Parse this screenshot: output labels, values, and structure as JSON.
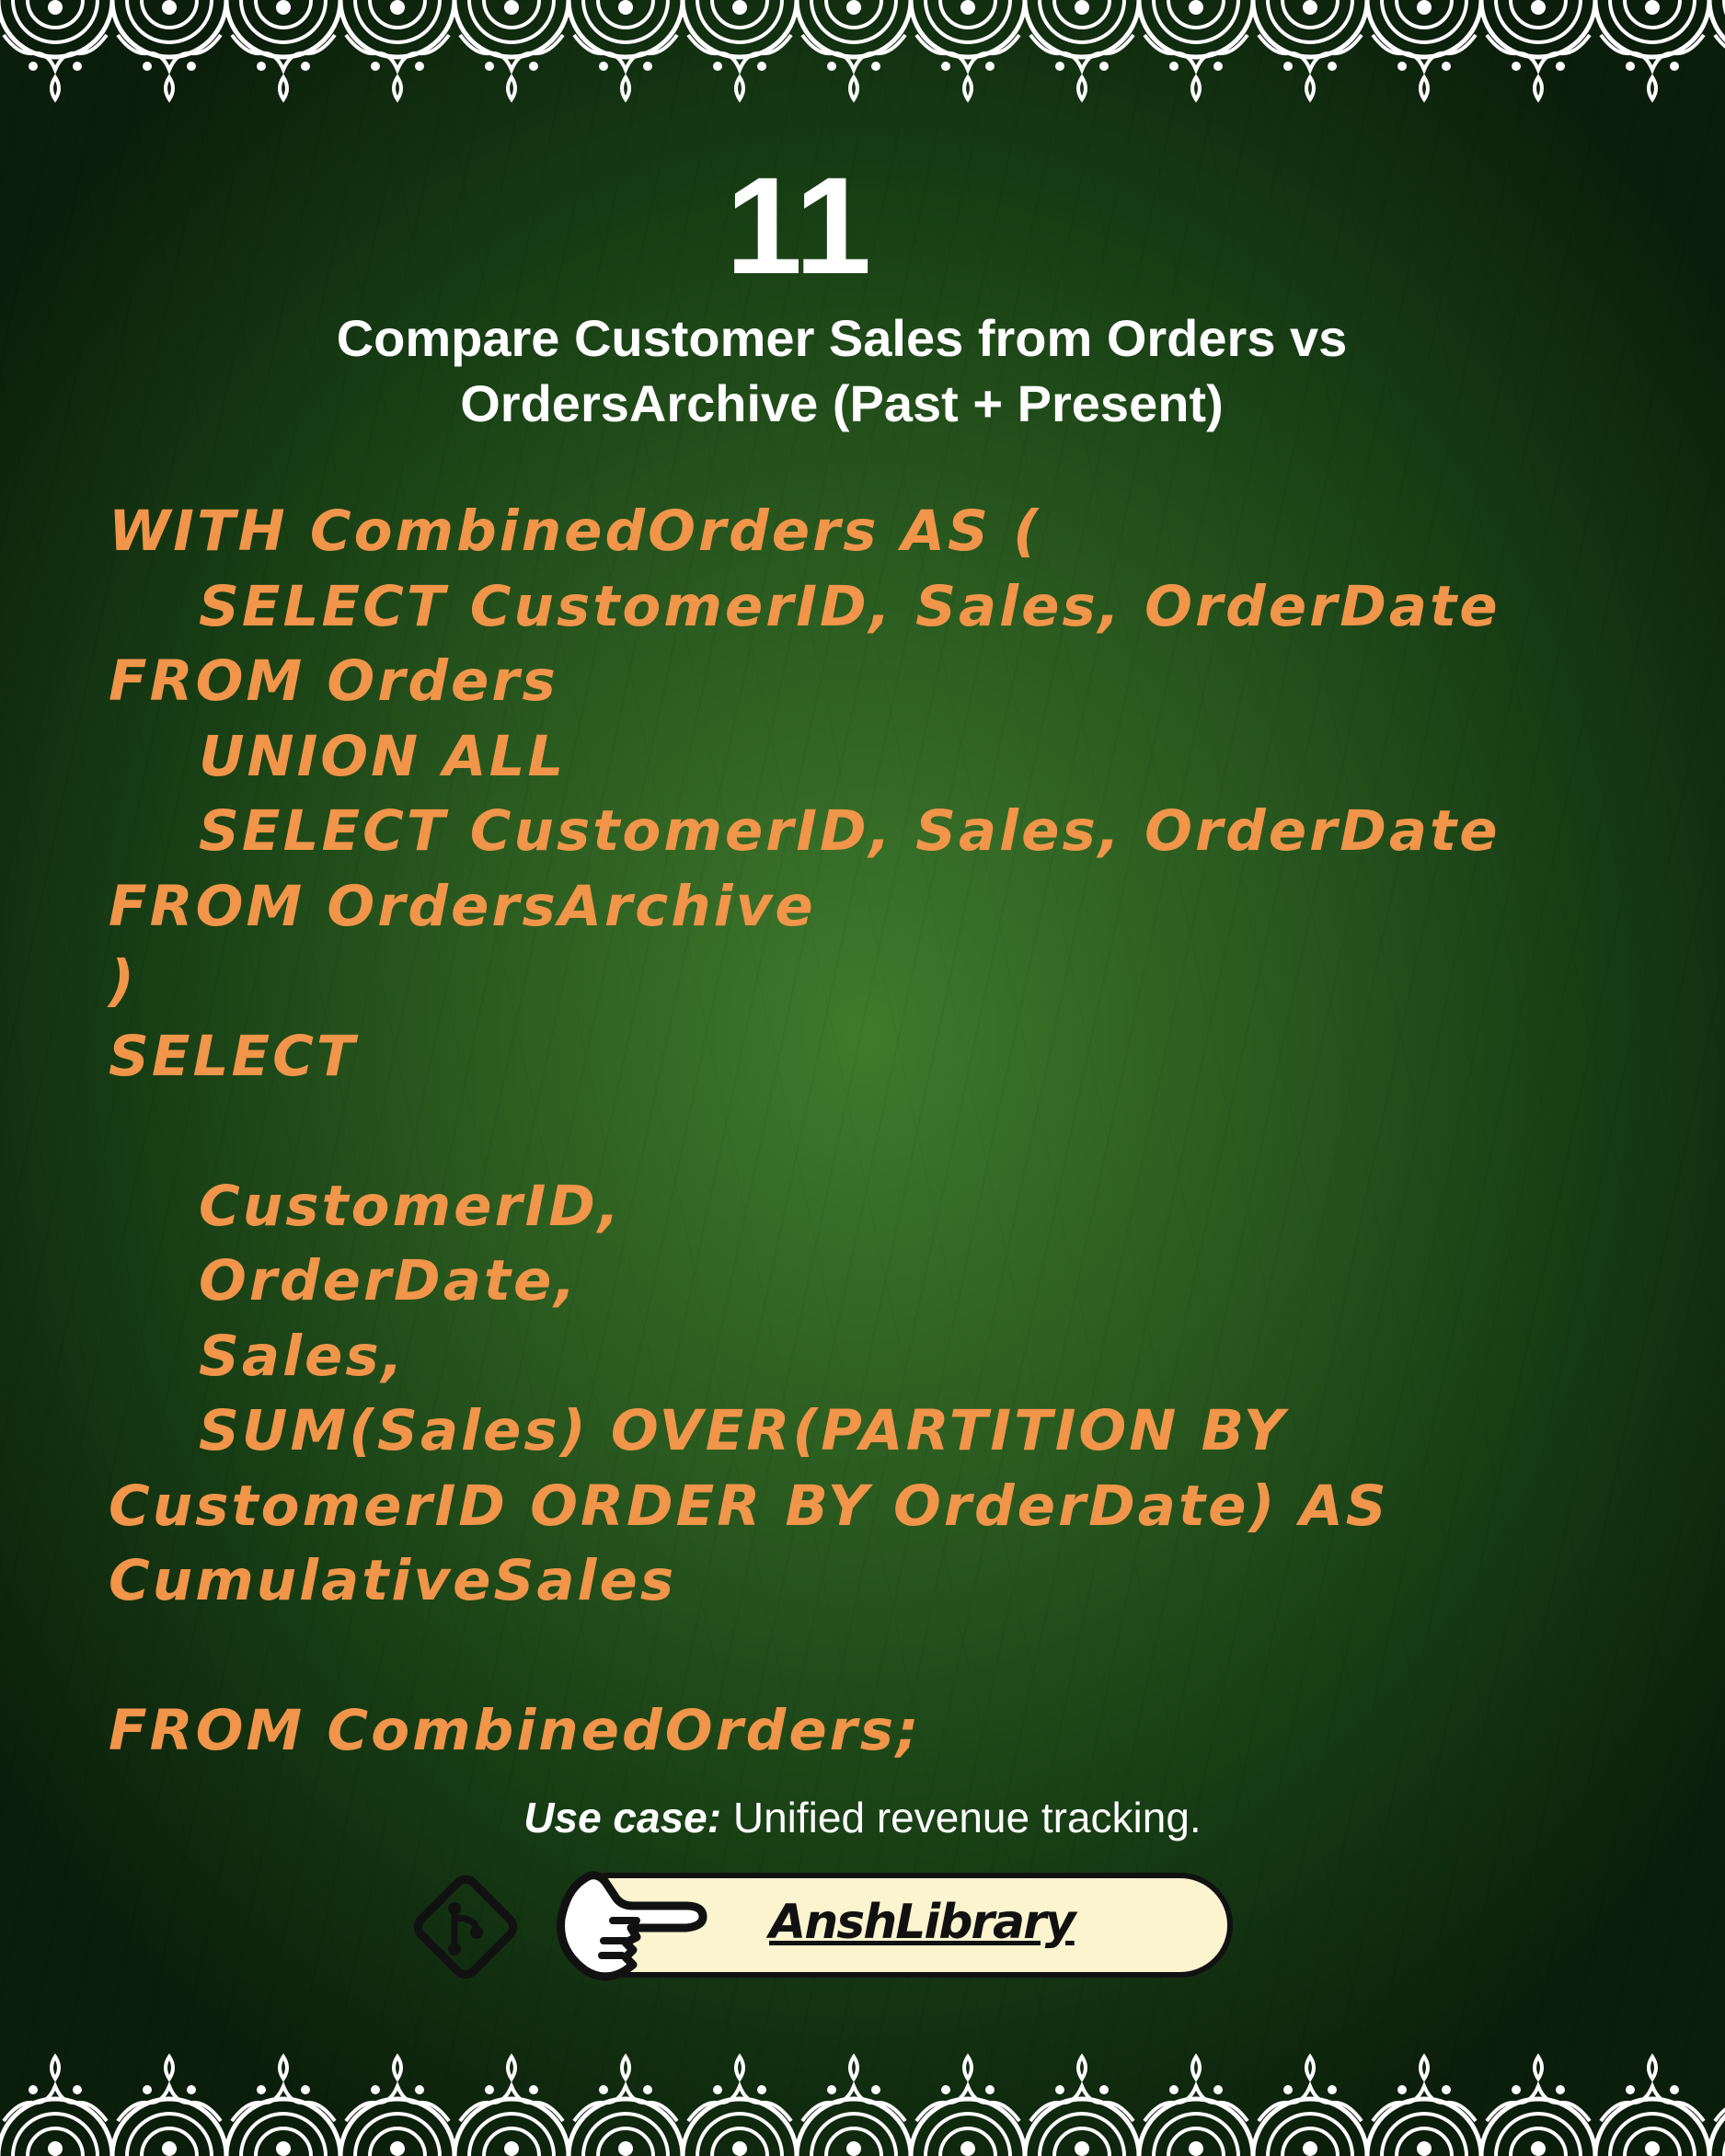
{
  "header": {
    "number": "11",
    "title_line1": "Compare Customer Sales from Orders vs",
    "title_line2": "OrdersArchive (Past + Present)"
  },
  "code_lines": [
    "WITH CombinedOrders AS (",
    "SELECT CustomerID, Sales, OrderDate",
    "FROM Orders",
    "UNION ALL",
    "SELECT CustomerID, Sales, OrderDate",
    "FROM OrdersArchive",
    ")",
    "SELECT",
    "",
    "CustomerID,",
    "OrderDate,",
    "Sales,",
    "SUM(Sales) OVER(PARTITION BY",
    "CustomerID ORDER BY OrderDate) AS",
    "CumulativeSales",
    "",
    "FROM CombinedOrders;"
  ],
  "footer": {
    "usecase_label": "Use case:",
    "usecase_text": " Unified revenue tracking.",
    "brand": "AnshLibrary"
  },
  "icons": [
    "git-branch-icon",
    "pointing-hand-icon"
  ],
  "colors": {
    "code": "#f0954a",
    "text": "#ffffff",
    "pill": "#fbf4cf",
    "background": "#2a5a1f"
  }
}
